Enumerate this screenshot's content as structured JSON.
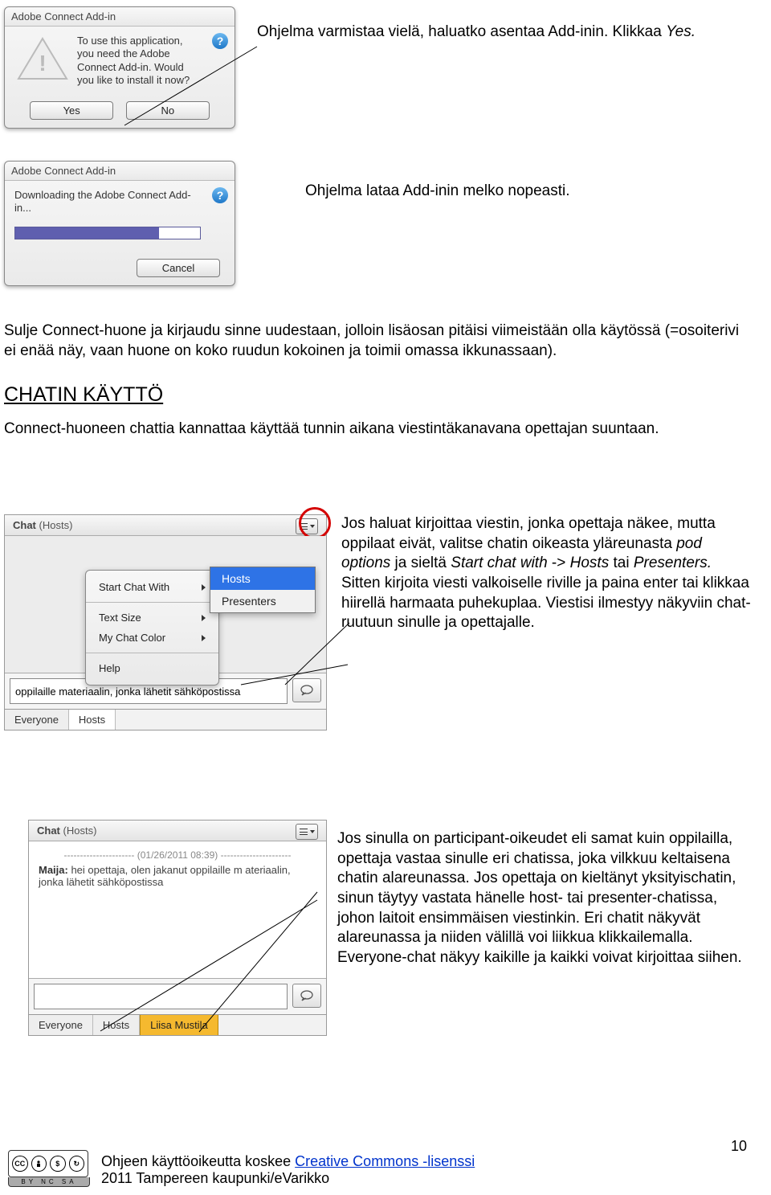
{
  "dlg1": {
    "title": "Adobe Connect Add-in",
    "text": "To use this application, you need the Adobe Connect Add-in. Would you like to install it now?",
    "yes": "Yes",
    "no": "No"
  },
  "dlg2": {
    "title": "Adobe Connect Add-in",
    "text": "Downloading the Adobe Connect Add-in...",
    "cancel": "Cancel"
  },
  "text1": "Ohjelma varmistaa vielä, haluatko asentaa Add-inin. Klikkaa ",
  "text1_italic": "Yes.",
  "text2": "Ohjelma lataa Add-inin melko nopeasti.",
  "text3": "Sulje Connect-huone ja kirjaudu sinne uudestaan, jolloin lisäosan pitäisi viimeistään olla käytössä (=osoiterivi ei enää näy, vaan huone on koko ruudun kokoinen ja toimii omassa ikkunassaan).",
  "section_title": "CHATIN KÄYTTÖ",
  "text4": "Connect-huoneen chattia kannattaa käyttää tunnin aikana viestintäkanavana opettajan suuntaan.",
  "chat_menu": {
    "header": "Chat",
    "header_sub": "(Hosts)",
    "item1": "Start Chat With",
    "item2": "Text Size",
    "item3": "My Chat Color",
    "item4": "Help",
    "sub1": "Hosts",
    "sub2": "Presenters",
    "input_value": "oppilaille materiaalin, jonka lähetit sähköpostissa",
    "tab1": "Everyone",
    "tab2": "Hosts"
  },
  "para_chat1_a": "Jos haluat kirjoittaa viestin, jonka opettaja näkee, mutta oppilaat eivät, valitse chatin oikeasta yläreunasta ",
  "para_chat1_b": "pod options",
  "para_chat1_c": " ja sieltä ",
  "para_chat1_d": "Start chat with",
  "para_chat1_e": " -> ",
  "para_chat1_f": "Hosts",
  "para_chat1_g": " tai ",
  "para_chat1_h": "Presenters.",
  "para_chat1_2": "Sitten kirjoita viesti valkoiselle riville ja paina enter tai klikkaa hiirellä harmaata puhekuplaa. Viestisi ilmestyy näkyviin chat-ruutuun sinulle ja opettajalle.",
  "chat2": {
    "header": "Chat",
    "header_sub": "(Hosts)",
    "timestamp": "---------------------- (01/26/2011 08:39) ----------------------",
    "sender": "Maija:",
    "msg": " hei opettaja, olen jakanut oppilaille m ateriaalin, jonka lähetit sähköpostissa",
    "tab1": "Everyone",
    "tab2": "Hosts",
    "tab3": "Liisa Mustila"
  },
  "para_chat2": "Jos sinulla on participant-oikeudet eli samat kuin oppilailla, opettaja vastaa sinulle eri chatissa, joka vilkkuu keltaisena chatin alareunassa. Jos opettaja on kieltänyt yksityischatin, sinun täytyy vastata hänelle host- tai presenter-chatissa, johon laitoit ensimmäisen viestinkin. Eri chatit näkyvät alareunassa ja niiden välillä voi liikkua klikkailemalla. Everyone-chat näkyy kaikille ja kaikki voivat kirjoittaa siihen.",
  "footer_text": "Ohjeen käyttöoikeutta koskee ",
  "footer_link": "Creative Commons -lisenssi",
  "footer_line2": "2011 Tampereen kaupunki/eVarikko",
  "cc_labels": "BY NC SA",
  "page_number": "10"
}
